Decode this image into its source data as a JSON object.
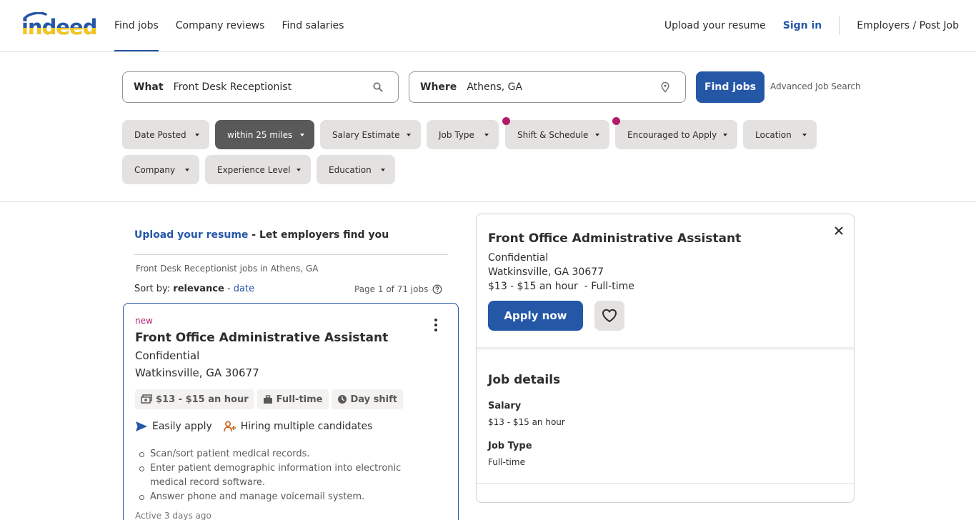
{
  "header": {
    "logo_text": "indeed",
    "nav": [
      "Find jobs",
      "Company reviews",
      "Find salaries"
    ],
    "upload_resume": "Upload your resume",
    "sign_in": "Sign in",
    "employers": "Employers / Post Job"
  },
  "search": {
    "what_label": "What",
    "what_value": "Front Desk Receptionist",
    "where_label": "Where",
    "where_value": "Athens, GA",
    "find_button": "Find jobs",
    "advanced": "Advanced Job Search"
  },
  "filters": [
    {
      "label": "Date Posted",
      "active": false,
      "dot": false
    },
    {
      "label": "within 25 miles",
      "active": true,
      "dot": false
    },
    {
      "label": "Salary Estimate",
      "active": false,
      "dot": false
    },
    {
      "label": "Job Type",
      "active": false,
      "dot": false
    },
    {
      "label": "Shift & Schedule",
      "active": false,
      "dot": true
    },
    {
      "label": "Encouraged to Apply",
      "active": false,
      "dot": true
    },
    {
      "label": "Location",
      "active": false,
      "dot": false
    },
    {
      "label": "Company",
      "active": false,
      "dot": false
    },
    {
      "label": "Experience Level",
      "active": false,
      "dot": false
    },
    {
      "label": "Education",
      "active": false,
      "dot": false
    }
  ],
  "results": {
    "upload_link": "Upload your resume",
    "upload_rest": " - Let employers find you",
    "breadcrumb": "Front Desk Receptionist jobs in Athens, GA",
    "sort_prefix": "Sort by: ",
    "sort_relevance": "relevance",
    "sort_sep": " - ",
    "sort_date": "date",
    "page_count": "Page 1 of 71 jobs"
  },
  "job_card": {
    "new_label": "new",
    "title": "Front Office Administrative Assistant",
    "company": "Confidential",
    "location": "Watkinsville, GA 30677",
    "tags": [
      "$13 - $15 an hour",
      "Full-time",
      "Day shift"
    ],
    "easily_apply": "Easily apply",
    "hiring": "Hiring multiple candidates",
    "snippets": [
      "Scan/sort patient medical records.",
      "Enter patient demographic information into electronic medical record software.",
      "Answer phone and manage voicemail system."
    ],
    "active": "Active 3 days ago"
  },
  "detail": {
    "title": "Front Office Administrative Assistant",
    "company": "Confidential",
    "location": "Watkinsville, GA 30677",
    "salary_type": "$13 - $15 an hour  - Full-time",
    "apply_button": "Apply now",
    "job_details_heading": "Job details",
    "salary_label": "Salary",
    "salary_value": "$13 - $15 an hour",
    "job_type_label": "Job Type",
    "job_type_value": "Full-time"
  },
  "colors": {
    "brand_blue": "#2557a7",
    "accent_pink": "#b31b6b",
    "chip_bg": "#e4e2e0",
    "chip_active_bg": "#595959"
  }
}
